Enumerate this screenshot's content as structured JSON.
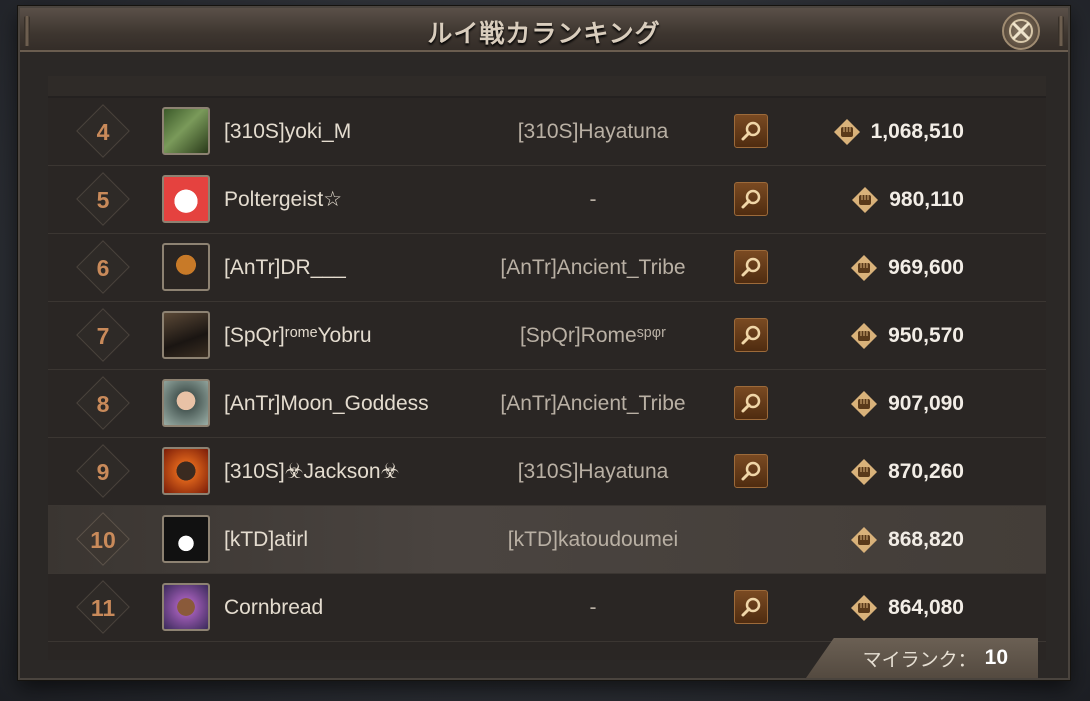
{
  "window": {
    "title": "ルイ戦カランキング"
  },
  "colors": {
    "rank": "#c98a5a",
    "power": "#f2ede6",
    "accent_button": "#7a4a22"
  },
  "rows": [
    {
      "rank": "4",
      "player": "[310S]yoki_M",
      "alliance": "[310S]Hayatuna",
      "power": "1,068,510",
      "avatar": "soldier-avatar",
      "has_view": true,
      "highlight": false
    },
    {
      "rank": "5",
      "player": "Poltergeist☆",
      "alliance": "-",
      "power": "980,110",
      "avatar": "ghost-avatar",
      "has_view": true,
      "highlight": false
    },
    {
      "rank": "6",
      "player": "[AnTr]DR___",
      "alliance": "[AnTr]Ancient_Tribe",
      "power": "969,600",
      "avatar": "helmet-avatar",
      "has_view": true,
      "highlight": false
    },
    {
      "rank": "7",
      "player": "[SpQr]ʳᵒᵐᵉYobru",
      "alliance": "[SpQr]Romeˢᵖᵠʳ",
      "power": "950,570",
      "avatar": "spartan-avatar",
      "has_view": true,
      "highlight": false
    },
    {
      "rank": "8",
      "player": "[AnTr]Moon_Goddess",
      "alliance": "[AnTr]Ancient_Tribe",
      "power": "907,090",
      "avatar": "woman-avatar",
      "has_view": true,
      "highlight": false
    },
    {
      "rank": "9",
      "player": "[310S]☣Jackson☣",
      "alliance": "[310S]Hayatuna",
      "power": "870,260",
      "avatar": "bear-avatar",
      "has_view": true,
      "highlight": false
    },
    {
      "rank": "10",
      "player": "[kTD]atirl",
      "alliance": "[kTD]katoudoumei",
      "power": "868,820",
      "avatar": "penguin-avatar",
      "has_view": false,
      "highlight": true
    },
    {
      "rank": "11",
      "player": "Cornbread",
      "alliance": "-",
      "power": "864,080",
      "avatar": "man-avatar",
      "has_view": true,
      "highlight": false
    }
  ],
  "footer": {
    "my_rank_label": "マイランク：",
    "my_rank_value": "10"
  },
  "icons": {
    "close": "close-x-icon",
    "view": "magnifier-icon",
    "power": "fist-icon"
  }
}
